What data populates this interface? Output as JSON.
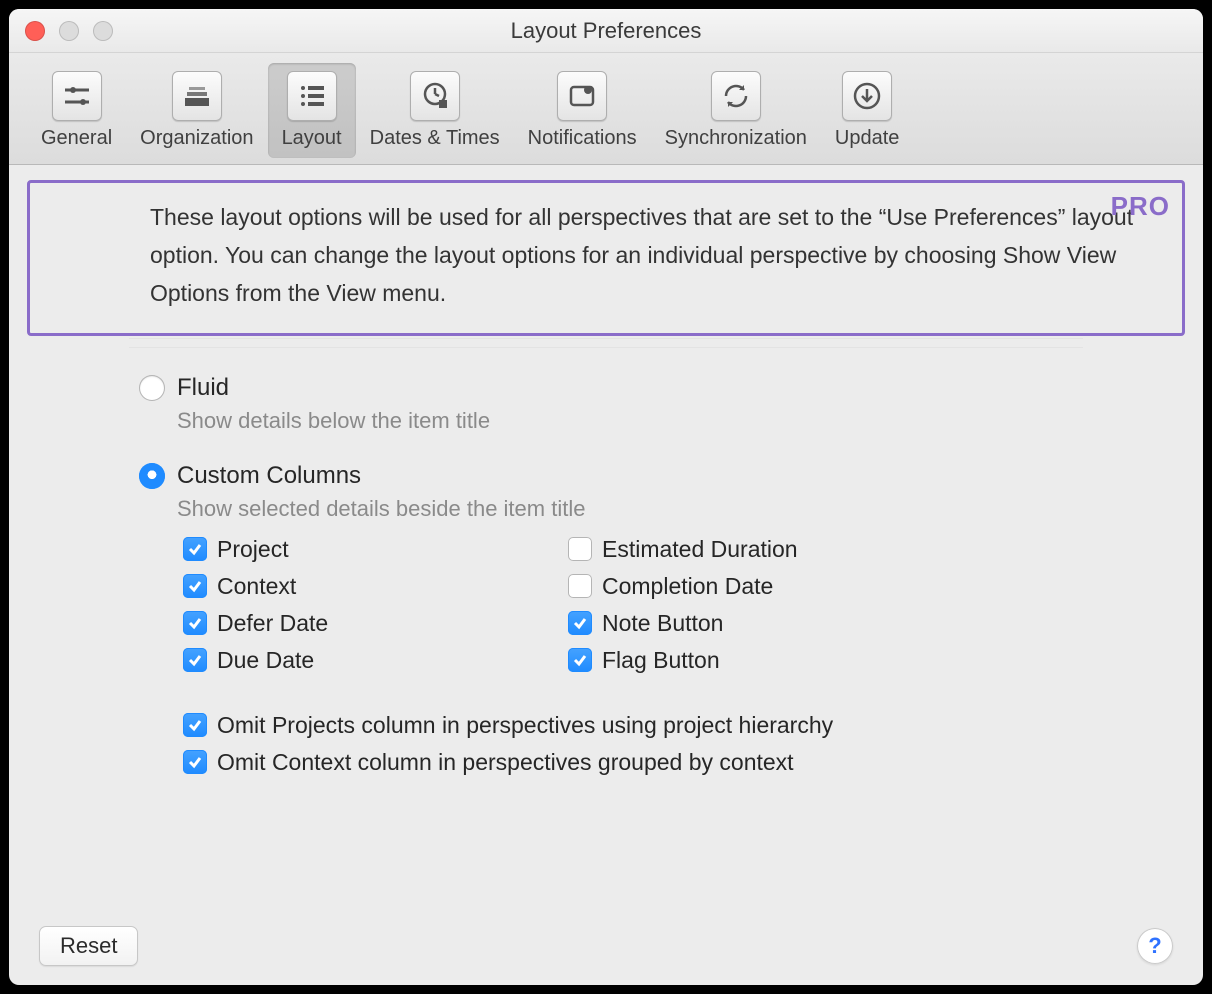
{
  "window": {
    "title": "Layout Preferences"
  },
  "toolbar": {
    "tabs": [
      {
        "label": "General"
      },
      {
        "label": "Organization"
      },
      {
        "label": "Layout"
      },
      {
        "label": "Dates & Times"
      },
      {
        "label": "Notifications"
      },
      {
        "label": "Synchronization"
      },
      {
        "label": "Update"
      }
    ],
    "selected_index": 2
  },
  "callout": {
    "badge": "PRO",
    "text": "These layout options will be used for all perspectives that are set to the “Use Preferences” layout option. You can change the layout options for an individual perspective by choosing Show View Options from the View menu."
  },
  "layout": {
    "fluid": {
      "label": "Fluid",
      "desc": "Show details below the item title",
      "selected": false
    },
    "custom": {
      "label": "Custom Columns",
      "desc": "Show selected details beside the item title",
      "selected": true
    }
  },
  "columns": {
    "project": {
      "label": "Project",
      "checked": true
    },
    "context": {
      "label": "Context",
      "checked": true
    },
    "defer": {
      "label": "Defer Date",
      "checked": true
    },
    "due": {
      "label": "Due Date",
      "checked": true
    },
    "estimated": {
      "label": "Estimated Duration",
      "checked": false
    },
    "completion": {
      "label": "Completion Date",
      "checked": false
    },
    "note": {
      "label": "Note Button",
      "checked": true
    },
    "flag": {
      "label": "Flag Button",
      "checked": true
    }
  },
  "omit": {
    "projects": {
      "label": "Omit Projects column in perspectives using project hierarchy",
      "checked": true
    },
    "context": {
      "label": "Omit Context column in perspectives grouped by context",
      "checked": true
    }
  },
  "footer": {
    "reset": "Reset",
    "help": "?"
  }
}
